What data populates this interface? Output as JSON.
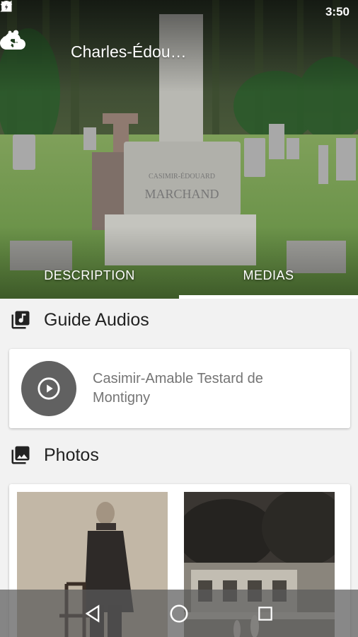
{
  "status_bar": {
    "time": "3:50",
    "icons": [
      "image-icon",
      "android-icon",
      "vibrate-icon",
      "wifi-icon",
      "no-signal-icon",
      "battery-charging-icon"
    ]
  },
  "app_bar": {
    "title": "Charles-Édou…",
    "back_icon": "arrow-back-icon",
    "actions": [
      "cloud-download-icon",
      "share-icon",
      "more-vert-icon"
    ]
  },
  "hero": {
    "monument_text_line1": "CASIMIR-ÉDOUARD",
    "monument_text_line2": "MARCHAND"
  },
  "tabs": [
    {
      "label": "DESCRIPTION",
      "active": false
    },
    {
      "label": "MEDIAS",
      "active": true
    }
  ],
  "audio_section": {
    "title": "Guide Audios",
    "icon": "library-music-icon",
    "items": [
      {
        "name": "Casimir-Amable Testard de Montigny",
        "icon": "play-circle-icon"
      }
    ]
  },
  "photos_section": {
    "title": "Photos",
    "icon": "photo-library-icon",
    "photos": [
      {
        "subject": "portrait"
      },
      {
        "subject": "house"
      }
    ]
  },
  "nav_bar": {
    "buttons": [
      "back-triangle-icon",
      "home-circle-icon",
      "recents-square-icon"
    ]
  },
  "colors": {
    "accent": "#616161",
    "background": "#f2f2f2",
    "card": "#ffffff",
    "tab_indicator": "#ffffff"
  }
}
